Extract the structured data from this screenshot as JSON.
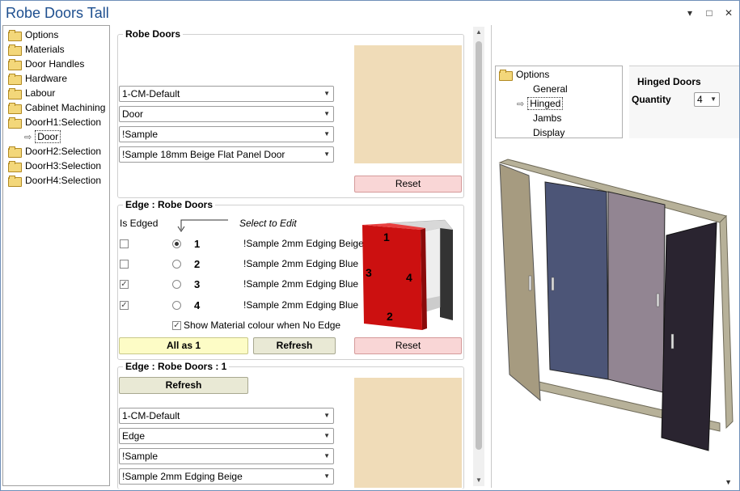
{
  "window": {
    "title": "Robe Doors Tall",
    "controls": [
      "▾",
      "□",
      "✕"
    ]
  },
  "tree": {
    "items": [
      {
        "label": "Options"
      },
      {
        "label": "Materials"
      },
      {
        "label": "Door Handles"
      },
      {
        "label": "Hardware"
      },
      {
        "label": "Labour"
      },
      {
        "label": "Cabinet Machining"
      },
      {
        "label": "DoorH1:Selection"
      },
      {
        "label": "Door"
      },
      {
        "label": "DoorH2:Selection"
      },
      {
        "label": "DoorH3:Selection"
      },
      {
        "label": "DoorH4:Selection"
      }
    ]
  },
  "robe_doors": {
    "title": "Robe Doors",
    "combos": [
      "1-CM-Default",
      "Door",
      "!Sample",
      "!Sample 18mm Beige Flat Panel Door"
    ],
    "reset": "Reset"
  },
  "edge": {
    "title": "Edge : Robe Doors",
    "is_edged": "Is Edged",
    "select_to_edit": "Select to Edit",
    "rows": [
      {
        "num": "1",
        "name": "!Sample 2mm Edging Beige",
        "checked": false,
        "selected": true
      },
      {
        "num": "2",
        "name": "!Sample 2mm Edging Blue",
        "checked": false,
        "selected": false
      },
      {
        "num": "3",
        "name": "!Sample 2mm Edging Blue",
        "checked": true,
        "selected": false
      },
      {
        "num": "4",
        "name": "!Sample 2mm Edging Blue",
        "checked": true,
        "selected": false
      }
    ],
    "show_material": "Show Material colour when No Edge",
    "all_as_1": "All as 1",
    "refresh": "Refresh",
    "reset": "Reset",
    "diagram_labels": [
      "1",
      "3",
      "4",
      "2"
    ]
  },
  "edge_1": {
    "title": "Edge : Robe Doors : 1",
    "refresh": "Refresh",
    "combos": [
      "1-CM-Default",
      "Edge",
      "!Sample",
      "!Sample 2mm Edging Beige"
    ]
  },
  "options_tree": {
    "root": "Options",
    "items": [
      "General",
      "Hinged",
      "Jambs",
      "Display"
    ]
  },
  "hinged": {
    "title": "Hinged Doors",
    "quantity_label": "Quantity",
    "quantity_value": "4"
  },
  "colors": {
    "accent": "#1e4f8f",
    "door_beige": "#a69b80",
    "door_blue": "#4c5577",
    "door_mauve": "#928592",
    "door_dark": "#2a2430",
    "edge_red": "#cc1010"
  }
}
